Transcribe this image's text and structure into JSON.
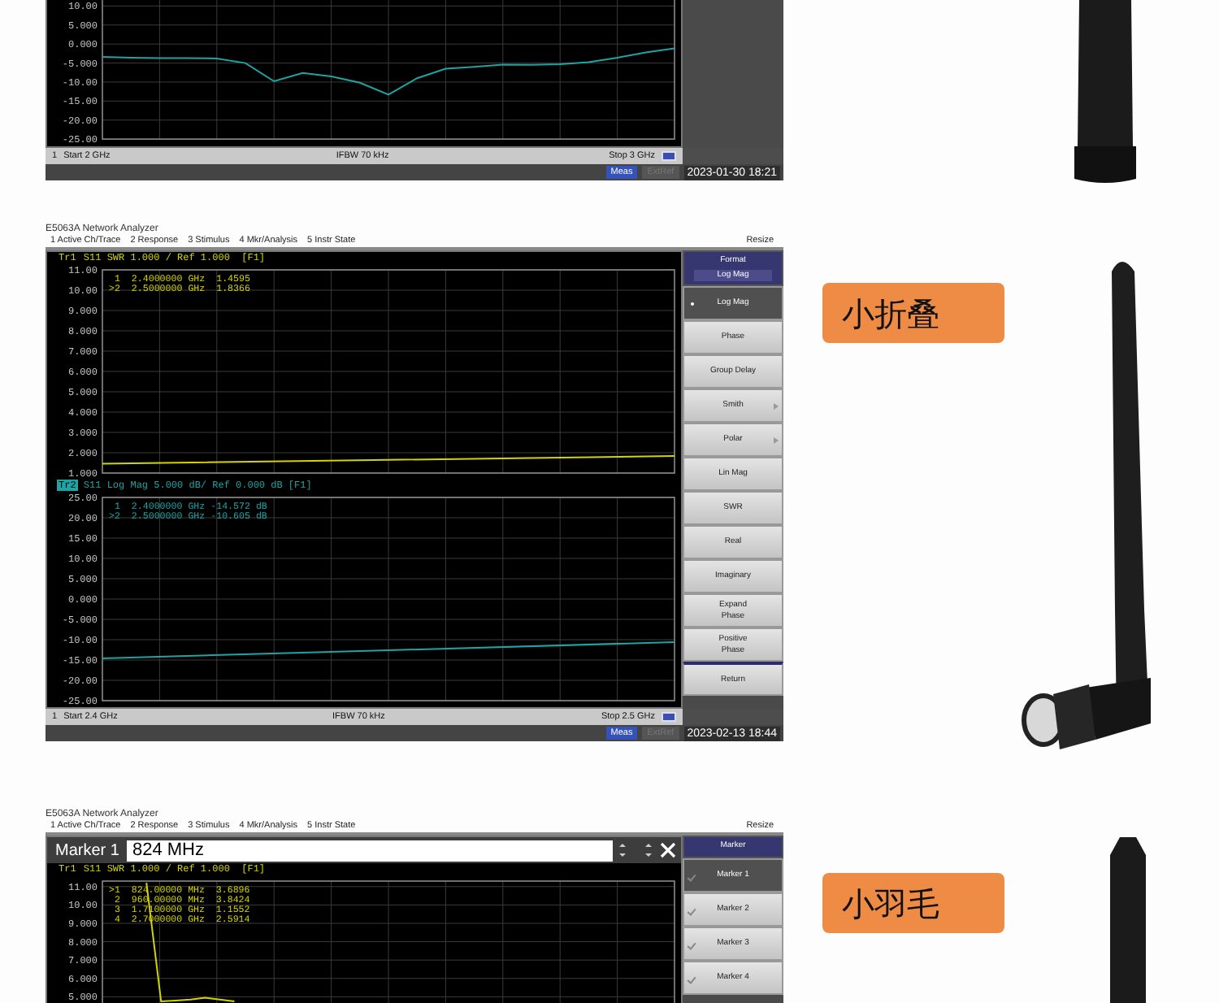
{
  "sections": [
    {
      "analyzer": {
        "plots": [
          {
            "chart_data": {
              "type": "line",
              "grid": true,
              "ylim": [
                -25,
                12
              ],
              "yticks": [
                {
                  "value": 10,
                  "label": "10.00"
                },
                {
                  "value": 5,
                  "label": "5.000"
                },
                {
                  "value": 0,
                  "label": "0.000"
                },
                {
                  "value": -5,
                  "label": "-5.000"
                },
                {
                  "value": -10,
                  "label": "-10.00"
                },
                {
                  "value": -15,
                  "label": "-15.00"
                },
                {
                  "value": -20,
                  "label": "-20.00"
                },
                {
                  "value": -25,
                  "label": "-25.00"
                }
              ],
              "categories": [
                null,
                null,
                null,
                null,
                null,
                null,
                null,
                null,
                null,
                null,
                null,
                null,
                null,
                null,
                null,
                null,
                null,
                null,
                null,
                null,
                null
              ],
              "series": [
                {
                  "color": "#1fa3a3",
                  "values": [
                    -3.4,
                    -3.6,
                    -3.7,
                    -3.7,
                    -3.8,
                    -5.0,
                    -9.8,
                    -7.6,
                    -8.5,
                    -10.2,
                    -13.3,
                    -9,
                    -6.5,
                    -6,
                    -5.4,
                    -5.5,
                    -5.3,
                    -4.8,
                    -3.6,
                    -2.2,
                    -1.1
                  ]
                }
              ]
            }
          }
        ],
        "bottom_bar": {
          "channel": "1",
          "start": "Start 2 GHz",
          "ifbw": "IFBW 70 kHz",
          "stop": "Stop 3 GHz"
        },
        "status": {
          "meas": "Meas",
          "ext_ref": "ExtRef",
          "ext_ref_active": false,
          "datetime": "2023-01-30 18:21"
        }
      },
      "antenna": {
        "kind": "stubby"
      }
    },
    {
      "analyzer": {
        "title": "E5063A Network Analyzer",
        "menu": [
          "1 Active Ch/Trace",
          "2 Response",
          "3 Stimulus",
          "4 Mkr/Analysis",
          "5 Instr State"
        ],
        "resize": "Resize",
        "plots": [
          {
            "trace": "Tr1",
            "active": false,
            "header": "S11 SWR 1.000 / Ref 1.000  [F1]",
            "color": "#d4d400",
            "readouts": [
              " 1  2.4000000 GHz  1.4595",
              ">2  2.5000000 GHz  1.8366"
            ],
            "chart_data": {
              "type": "line",
              "grid": true,
              "ylim": [
                1,
                11
              ],
              "yticks": [
                {
                  "value": 11,
                  "label": "11.00"
                },
                {
                  "value": 10,
                  "label": "10.00"
                },
                {
                  "value": 9,
                  "label": "9.000"
                },
                {
                  "value": 8,
                  "label": "8.000"
                },
                {
                  "value": 7,
                  "label": "7.000"
                },
                {
                  "value": 6,
                  "label": "6.000"
                },
                {
                  "value": 5,
                  "label": "5.000"
                },
                {
                  "value": 4,
                  "label": "4.000"
                },
                {
                  "value": 3,
                  "label": "3.000"
                },
                {
                  "value": 2,
                  "label": "2.000"
                },
                {
                  "value": 1,
                  "label": "1.000"
                }
              ],
              "categories": [
                null,
                null,
                null
              ],
              "series": [
                {
                  "color": "#d4d400",
                  "values": [
                    1.46,
                    1.65,
                    1.84
                  ]
                }
              ]
            }
          },
          {
            "trace": "Tr2",
            "active": true,
            "header": "S11 Log Mag 5.000 dB/ Ref 0.000 dB [F1]",
            "color": "#1fa3a3",
            "readouts": [
              " 1  2.4000000 GHz -14.572 dB",
              ">2  2.5000000 GHz -10.605 dB"
            ],
            "chart_data": {
              "type": "line",
              "grid": true,
              "ylim": [
                -25,
                25
              ],
              "yticks": [
                {
                  "value": 25,
                  "label": "25.00"
                },
                {
                  "value": 20,
                  "label": "20.00"
                },
                {
                  "value": 15,
                  "label": "15.00"
                },
                {
                  "value": 10,
                  "label": "10.00"
                },
                {
                  "value": 5,
                  "label": "5.000"
                },
                {
                  "value": 0,
                  "label": "0.000"
                },
                {
                  "value": -5,
                  "label": "-5.000"
                },
                {
                  "value": -10,
                  "label": "-10.00"
                },
                {
                  "value": -15,
                  "label": "-15.00"
                },
                {
                  "value": -20,
                  "label": "-20.00"
                },
                {
                  "value": -25,
                  "label": "-25.00"
                }
              ],
              "categories": [
                null,
                null,
                null
              ],
              "series": [
                {
                  "color": "#1fa3a3",
                  "values": [
                    -14.6,
                    -12.6,
                    -10.6
                  ]
                }
              ]
            }
          }
        ],
        "softkeys": [
          {
            "kind": "header",
            "label": "Format",
            "value": "Log Mag"
          },
          {
            "kind": "key",
            "label": "Log Mag",
            "selected": true,
            "submenu": false
          },
          {
            "kind": "key",
            "label": "Phase",
            "selected": false,
            "submenu": false
          },
          {
            "kind": "key",
            "label": "Group Delay",
            "selected": false,
            "submenu": false
          },
          {
            "kind": "key",
            "label": "Smith",
            "selected": false,
            "submenu": true
          },
          {
            "kind": "key",
            "label": "Polar",
            "selected": false,
            "submenu": true
          },
          {
            "kind": "key",
            "label": "Lin Mag",
            "selected": false,
            "submenu": false
          },
          {
            "kind": "key",
            "label": "SWR",
            "selected": false,
            "submenu": false
          },
          {
            "kind": "key",
            "label": "Real",
            "selected": false,
            "submenu": false
          },
          {
            "kind": "key",
            "label": "Imaginary",
            "selected": false,
            "submenu": false
          },
          {
            "kind": "key",
            "label": "Expand\nPhase",
            "selected": false,
            "submenu": false
          },
          {
            "kind": "key",
            "label": "Positive\nPhase",
            "selected": false,
            "submenu": false
          },
          {
            "kind": "return",
            "label": "Return"
          }
        ],
        "bottom_bar": {
          "channel": "1",
          "start": "Start 2.4 GHz",
          "ifbw": "IFBW 70 kHz",
          "stop": "Stop 2.5 GHz"
        },
        "status": {
          "meas": "Meas",
          "ext_ref": "ExtRef",
          "ext_ref_active": false,
          "datetime": "2023-02-13 18:44"
        }
      },
      "label": "小折叠",
      "antenna": {
        "kind": "folding"
      }
    },
    {
      "analyzer": {
        "title": "E5063A Network Analyzer",
        "menu": [
          "1 Active Ch/Trace",
          "2 Response",
          "3 Stimulus",
          "4 Mkr/Analysis",
          "5 Instr State"
        ],
        "resize": "Resize",
        "entry": {
          "label": "Marker 1",
          "value": "824 MHz"
        },
        "plots": [
          {
            "trace": "Tr1",
            "active": false,
            "header": "S11 SWR 1.000 / Ref 1.000  [F1]",
            "color": "#d4d400",
            "readouts": [
              ">1  824.00000 MHz  3.6896",
              " 2  960.00000 MHz  3.8424",
              " 3  1.7100000 GHz  1.1552",
              " 4  2.7000000 GHz  2.5914"
            ],
            "chart_data": {
              "type": "line",
              "grid": true,
              "ylim": [
                4.6,
                11.3
              ],
              "yticks": [
                {
                  "value": 11,
                  "label": "11.00"
                },
                {
                  "value": 10,
                  "label": "10.00"
                },
                {
                  "value": 9,
                  "label": "9.000"
                },
                {
                  "value": 8,
                  "label": "8.000"
                },
                {
                  "value": 7,
                  "label": "7.000"
                },
                {
                  "value": 6,
                  "label": "6.000"
                },
                {
                  "value": 5,
                  "label": "5.000"
                }
              ],
              "categories": [
                null,
                null,
                null,
                null,
                null,
                null,
                null,
                null,
                null,
                null,
                null,
                null,
                null,
                null,
                null,
                null,
                null,
                null,
                null,
                null,
                null,
                null,
                null,
                null,
                null,
                null,
                null,
                null,
                null,
                null,
                null,
                null,
                null,
                null,
                null,
                null,
                null,
                null,
                null,
                null
              ],
              "series": [
                {
                  "color": "#d4d400",
                  "values": [
                    null,
                    null,
                    null,
                    11.2,
                    4.75,
                    4.8,
                    4.85,
                    4.95,
                    4.85,
                    4.75,
                    null,
                    null,
                    null,
                    null,
                    null,
                    null,
                    null,
                    null,
                    null,
                    null,
                    null,
                    null,
                    null,
                    null,
                    null,
                    null,
                    null,
                    null,
                    null,
                    null,
                    null,
                    null,
                    null,
                    null,
                    null,
                    null,
                    null,
                    null,
                    null,
                    null
                  ]
                }
              ]
            }
          }
        ],
        "softkeys": [
          {
            "kind": "header",
            "label": "Marker"
          },
          {
            "kind": "key",
            "label": "Marker 1",
            "selected": true,
            "checked": true
          },
          {
            "kind": "key",
            "label": "Marker 2",
            "selected": false,
            "checked": true
          },
          {
            "kind": "key",
            "label": "Marker 3",
            "selected": false,
            "checked": true
          },
          {
            "kind": "key",
            "label": "Marker 4",
            "selected": false,
            "checked": true
          }
        ]
      },
      "label": "小羽毛",
      "antenna": {
        "kind": "whip"
      }
    }
  ]
}
